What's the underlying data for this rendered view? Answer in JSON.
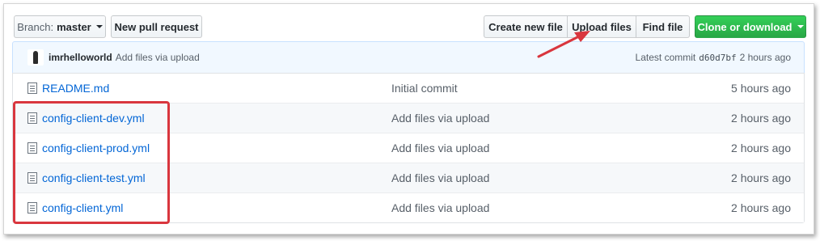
{
  "toolbar": {
    "branch_prefix": "Branch:",
    "branch_name": "master",
    "new_pull_request": "New pull request",
    "create_new_file": "Create new file",
    "upload_files": "Upload files",
    "find_file": "Find file",
    "clone_or_download": "Clone or download"
  },
  "commit_bar": {
    "author": "imrhelloworld",
    "message": "Add files via upload",
    "latest_label": "Latest commit",
    "sha": "d60d7bf",
    "age": "2 hours ago"
  },
  "files": [
    {
      "name": "README.md",
      "message": "Initial commit",
      "age": "5 hours ago"
    },
    {
      "name": "config-client-dev.yml",
      "message": "Add files via upload",
      "age": "2 hours ago"
    },
    {
      "name": "config-client-prod.yml",
      "message": "Add files via upload",
      "age": "2 hours ago"
    },
    {
      "name": "config-client-test.yml",
      "message": "Add files via upload",
      "age": "2 hours ago"
    },
    {
      "name": "config-client.yml",
      "message": "Add files via upload",
      "age": "2 hours ago"
    }
  ],
  "colors": {
    "annotation": "#d9363e",
    "link": "#0366d6",
    "green_button": "#28a745"
  },
  "icons": [
    "caret-down-icon",
    "file-icon",
    "avatar",
    "annotation-arrow"
  ]
}
